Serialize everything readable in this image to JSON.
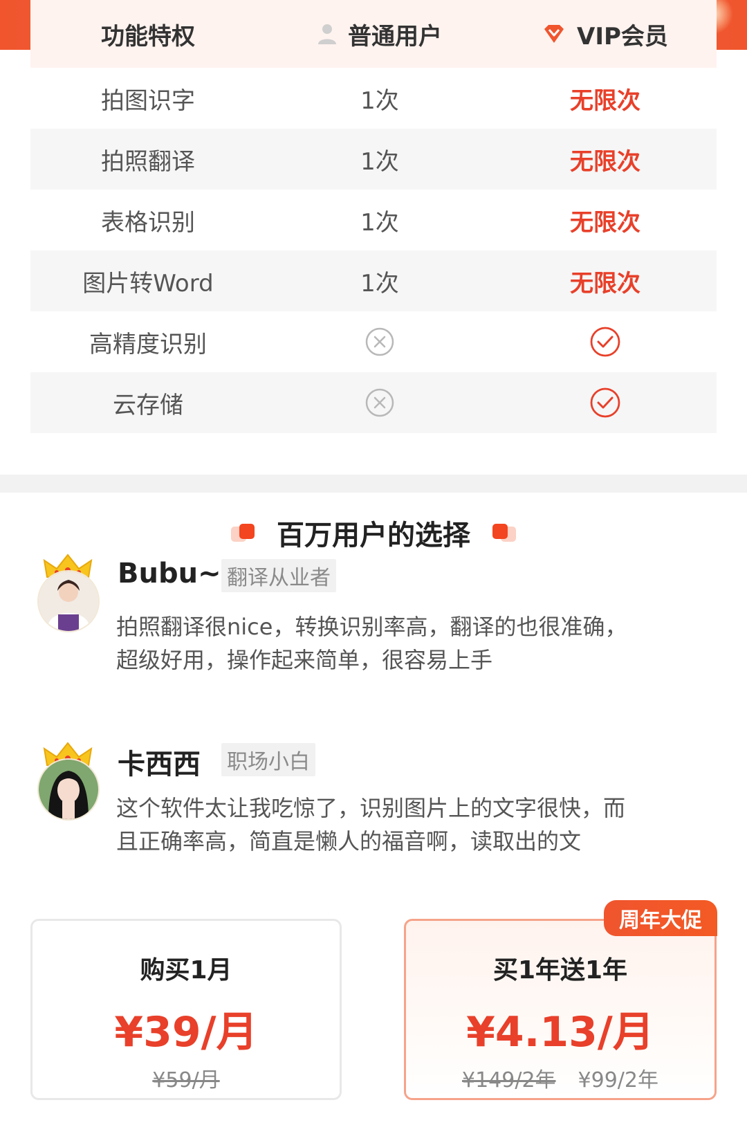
{
  "comparison": {
    "headers": {
      "feature": "功能特权",
      "normal": "普通用户",
      "vip": "VIP会员"
    },
    "rows": [
      {
        "feature": "拍图识字",
        "normal": "1次",
        "vip": "无限次"
      },
      {
        "feature": "拍照翻译",
        "normal": "1次",
        "vip": "无限次"
      },
      {
        "feature": "表格识别",
        "normal": "1次",
        "vip": "无限次"
      },
      {
        "feature": "图片转Word",
        "normal": "1次",
        "vip": "无限次"
      },
      {
        "feature": "高精度识别",
        "normal_icon": "cross-circle-icon",
        "vip_icon": "check-circle-icon"
      },
      {
        "feature": "云存储",
        "normal_icon": "cross-circle-icon",
        "vip_icon": "check-circle-icon"
      }
    ]
  },
  "testimonials": {
    "title": "百万用户的选择",
    "items": [
      {
        "name": "Bubu~",
        "tag": "翻译从业者",
        "text": "拍照翻译很nice，转换识别率高，翻译的也很准确，超级好用，操作起来简单，很容易上手"
      },
      {
        "name": "卡西西",
        "tag": "职场小白",
        "text": "这个软件太让我吃惊了，识别图片上的文字很快，而且正确率高，简直是懒人的福音啊，读取出的文"
      }
    ]
  },
  "plans": [
    {
      "name": "购买1月",
      "price": "¥39/月",
      "original": "¥59/月"
    },
    {
      "name": "买1年送1年",
      "price": "¥4.13/月",
      "original": "¥149/2年",
      "current_total": "¥99/2年",
      "badge": "周年大促"
    }
  ],
  "colors": {
    "accent": "#e8402a",
    "header_bg": "#fff3ef",
    "stripe": "#f6f6f6"
  }
}
